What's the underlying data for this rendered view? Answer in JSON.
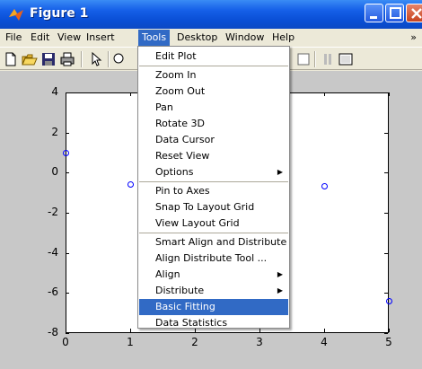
{
  "window": {
    "title": "Figure 1"
  },
  "menubar": {
    "items": [
      "File",
      "Edit",
      "View",
      "Insert",
      "Tools",
      "Desktop",
      "Window",
      "Help"
    ],
    "active": "Tools",
    "end_arrow": "»"
  },
  "tools_menu": {
    "groups": [
      [
        "Edit Plot"
      ],
      [
        "Zoom In",
        "Zoom Out",
        "Pan",
        "Rotate 3D",
        "Data Cursor",
        "Reset View",
        "Options"
      ],
      [
        "Pin to Axes",
        "Snap To Layout Grid",
        "View Layout Grid"
      ],
      [
        "Smart Align and Distribute",
        "Align Distribute Tool ...",
        "Align",
        "Distribute"
      ],
      [
        "Basic Fitting",
        "Data Statistics"
      ]
    ],
    "submenu_items": [
      "Options",
      "Align",
      "Distribute"
    ],
    "highlighted": "Basic Fitting"
  },
  "colors": {
    "menu_highlight": "#316ac5",
    "titlebar": "#0a4fd6",
    "marker": "#0000ff"
  },
  "chart_data": {
    "type": "scatter",
    "title": "",
    "xlabel": "",
    "ylabel": "",
    "xlim": [
      0,
      5
    ],
    "ylim": [
      -8,
      4
    ],
    "xticks": [
      0,
      1,
      2,
      3,
      4,
      5
    ],
    "yticks": [
      4,
      2,
      0,
      -2,
      -4,
      -6,
      -8
    ],
    "series": [
      {
        "marker": "circle",
        "color": "#0000ff",
        "x": [
          0,
          1,
          4,
          5
        ],
        "y": [
          1,
          -0.6,
          -0.7,
          -6.4
        ]
      }
    ]
  }
}
